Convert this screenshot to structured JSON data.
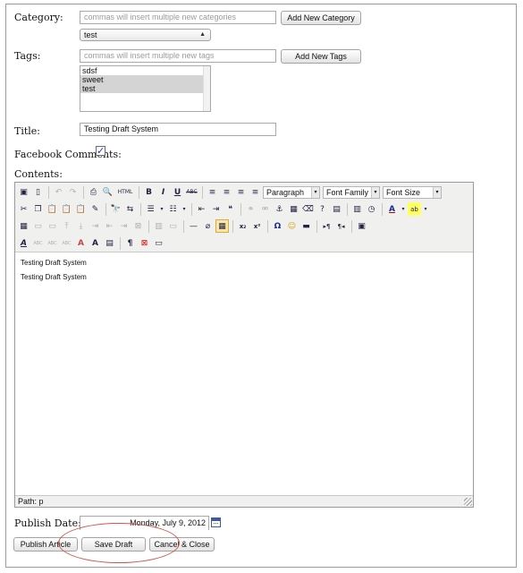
{
  "category": {
    "label": "Category:",
    "input_placeholder": "commas will insert multiple new categories",
    "add_button": "Add New Category",
    "selected": "test"
  },
  "tags": {
    "label": "Tags:",
    "input_placeholder": "commas will insert multiple new tags",
    "add_button": "Add New Tags",
    "options": [
      {
        "label": "sdsf",
        "selected": false
      },
      {
        "label": "sweet",
        "selected": true
      },
      {
        "label": "test",
        "selected": true
      }
    ]
  },
  "title": {
    "label": "Title:",
    "value": "Testing Draft System"
  },
  "facebook": {
    "label": "Facebook Comments:",
    "checked": true,
    "check_glyph": "☑"
  },
  "contents": {
    "label": "Contents:",
    "toolbar": {
      "format_select": "Paragraph",
      "font_family_select": "Font Family",
      "font_size_select": "Font Size",
      "html_button": "HTML",
      "bold": "B",
      "italic": "I",
      "underline": "U",
      "strikethrough": "ABC",
      "subscript": "x₂",
      "superscript": "x²",
      "omega": "Ω",
      "smiley": "🙂",
      "pilcrow": "¶",
      "font_color": "A",
      "highlight": "ab",
      "text_a": "A"
    },
    "body_lines": [
      "Testing Draft System",
      "Testing Draft System"
    ],
    "path_label": "Path: p"
  },
  "publish_date": {
    "label": "Publish Date:",
    "value": "Monday, July 9, 2012"
  },
  "buttons": {
    "publish": "Publish Article",
    "save_draft": "Save Draft",
    "cancel": "Cancel & Close"
  },
  "colors": {
    "annotation_circle": "#d0544a",
    "checkbox_mark": "#1a3fb0"
  }
}
